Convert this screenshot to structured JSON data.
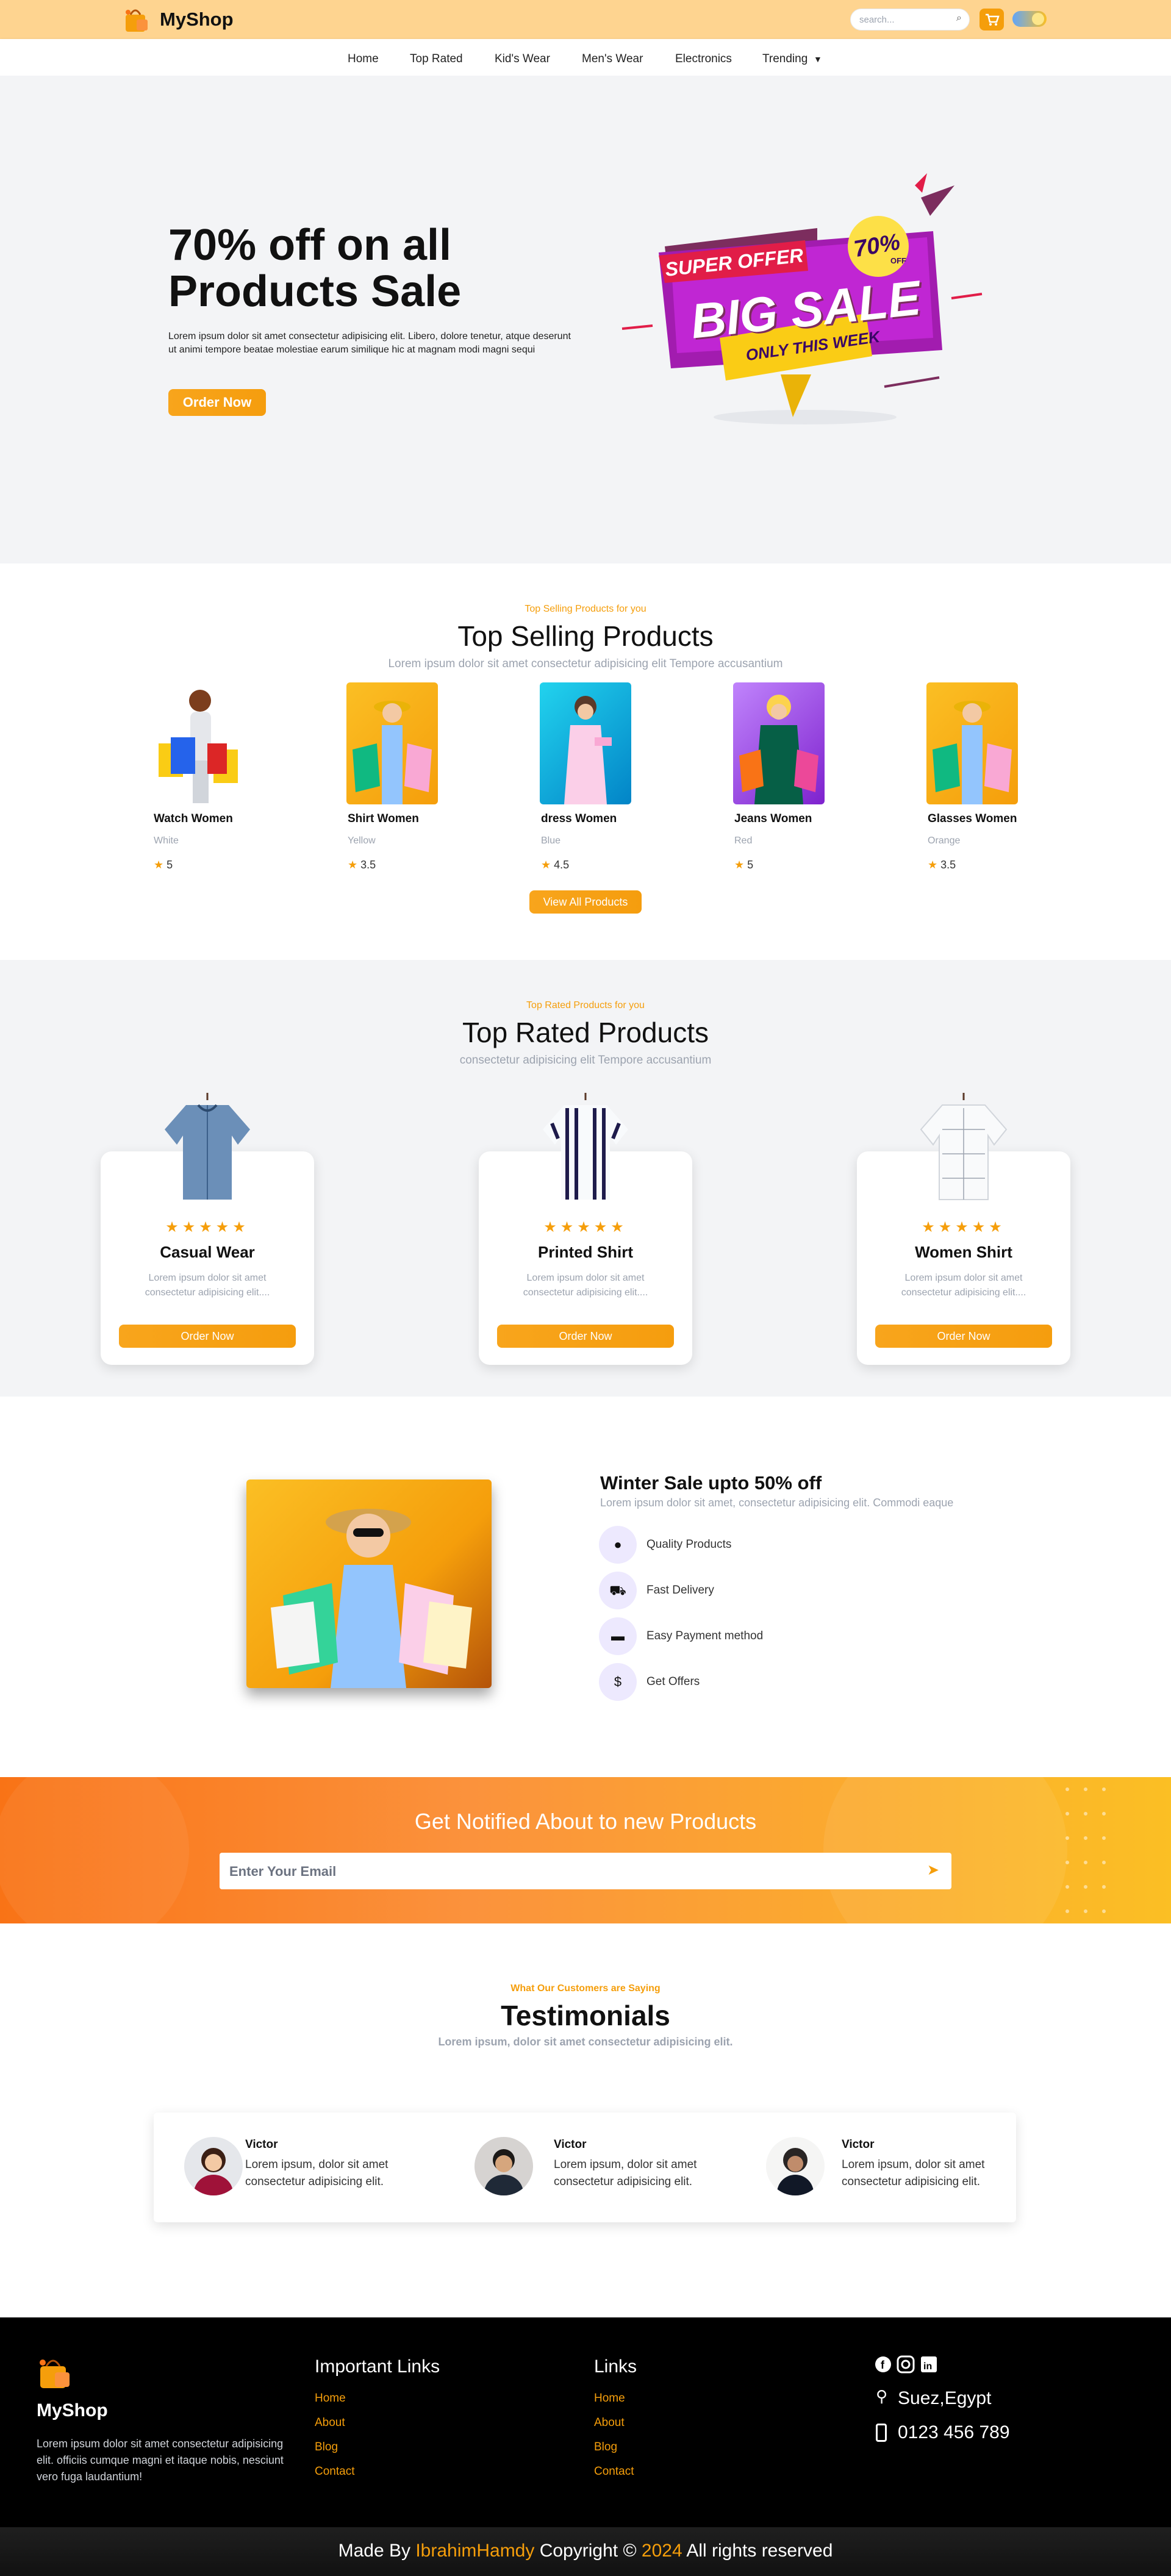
{
  "header": {
    "brand": "MyShop",
    "search_placeholder": "search...",
    "icons": [
      "shopping-bag-logo-icon",
      "search-icon",
      "cart-icon",
      "theme-toggle-icon"
    ]
  },
  "nav": {
    "items": [
      "Home",
      "Top Rated",
      "Kid's Wear",
      "Men's Wear",
      "Electronics",
      "Trending"
    ]
  },
  "hero": {
    "title_line1": "70% off on all",
    "title_line2": "Products Sale",
    "text": "Lorem ipsum dolor sit amet consectetur adipisicing elit. Libero, dolore tenetur, atque deserunt ut animi tempore beatae molestiae earum similique hic at magnam modi magni sequi",
    "button": "Order Now",
    "badge": {
      "super_offer": "SUPER OFFER",
      "big_sale": "BIG SALE",
      "only_this_week": "ONLY THIS WEEK",
      "percent": "70%",
      "off": "OFF"
    }
  },
  "top_selling": {
    "subtitle": "Top Selling Products for you",
    "title": "Top Selling Products",
    "desc": "Lorem ipsum dolor sit amet consectetur adipisicing elit Tempore accusantium",
    "products": [
      {
        "name": "Watch Women",
        "color": "White",
        "rating": "5"
      },
      {
        "name": "Shirt Women",
        "color": "Yellow",
        "rating": "3.5"
      },
      {
        "name": "dress Women",
        "color": "Blue",
        "rating": "4.5"
      },
      {
        "name": "Jeans Women",
        "color": "Red",
        "rating": "5"
      },
      {
        "name": "Glasses Women",
        "color": "Orange",
        "rating": "3.5"
      }
    ],
    "button": "View All Products"
  },
  "top_rated": {
    "subtitle": "Top Rated Products for you",
    "title": "Top Rated Products",
    "desc": "consectetur adipisicing elit Tempore accusantium",
    "cards": [
      {
        "name": "Casual Wear",
        "text": "Lorem ipsum dolor sit amet consectetur adipisicing elit....",
        "button": "Order Now",
        "stars": 5
      },
      {
        "name": "Printed Shirt",
        "text": "Lorem ipsum dolor sit amet consectetur adipisicing elit....",
        "button": "Order Now",
        "stars": 5
      },
      {
        "name": "Women Shirt",
        "text": "Lorem ipsum dolor sit amet consectetur adipisicing elit....",
        "button": "Order Now",
        "stars": 5
      }
    ]
  },
  "winter": {
    "title": "Winter Sale upto 50% off",
    "desc": "Lorem ipsum dolor sit amet, consectetur adipisicing elit. Commodi eaque",
    "features": [
      "Quality Products",
      "Fast Delivery",
      "Easy Payment method",
      "Get Offers"
    ]
  },
  "newsletter": {
    "title": "Get Notified About to new Products",
    "placeholder": "Enter Your Email"
  },
  "testimonials": {
    "subtitle": "What Our Customers are Saying",
    "title": "Testimonials",
    "desc": "Lorem ipsum, dolor sit amet consectetur adipisicing elit.",
    "items": [
      {
        "name": "Victor",
        "text": "Lorem ipsum, dolor sit amet consectetur adipisicing elit."
      },
      {
        "name": "Victor",
        "text": "Lorem ipsum, dolor sit amet consectetur adipisicing elit."
      },
      {
        "name": "Victor",
        "text": "Lorem ipsum, dolor sit amet consectetur adipisicing elit."
      }
    ]
  },
  "footer": {
    "brand": "MyShop",
    "about": "Lorem ipsum dolor sit amet consectetur adipisicing elit. officiis cumque magni et itaque nobis, nesciunt vero fuga laudantium!",
    "important_links_title": "Important Links",
    "important_links": [
      "Home",
      "About",
      "Blog",
      "Contact"
    ],
    "links_title": "Links",
    "links": [
      "Home",
      "About",
      "Blog",
      "Contact"
    ],
    "location": "Suez,Egypt",
    "phone": "0123 456 789",
    "copyright_prefix": "Made By ",
    "author": "IbrahimHamdy",
    "copyright_mid": " Copyright © ",
    "year": "2024",
    "copyright_suffix": " All rights reserved"
  },
  "colors": {
    "accent": "#f59e0b",
    "topbar": "#fed490",
    "footer": "#000000"
  }
}
